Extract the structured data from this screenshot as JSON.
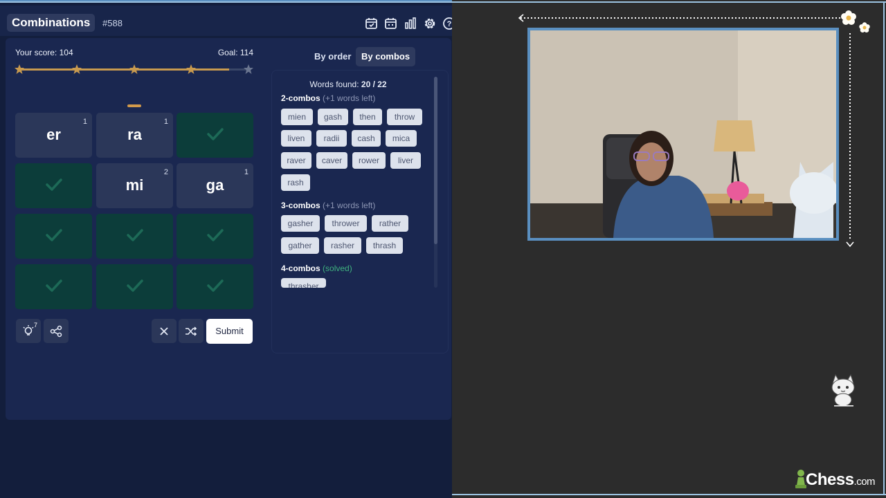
{
  "app": {
    "title": "Combinations",
    "puzzle_number": "#588"
  },
  "toolbar_icons": [
    "calendar-check-icon",
    "calendar-icon",
    "bar-chart-icon",
    "gear-icon",
    "help-icon"
  ],
  "score": {
    "label": "Your score: 104",
    "goal": "Goal: 114",
    "value": 104,
    "goal_value": 114,
    "stars_earned": 4,
    "stars_total": 5
  },
  "tiles": [
    {
      "label": "er",
      "count": "1",
      "done": false
    },
    {
      "label": "ra",
      "count": "1",
      "done": false
    },
    {
      "label": "",
      "count": "",
      "done": true
    },
    {
      "label": "",
      "count": "",
      "done": true
    },
    {
      "label": "mi",
      "count": "2",
      "done": false
    },
    {
      "label": "ga",
      "count": "1",
      "done": false
    },
    {
      "label": "",
      "count": "",
      "done": true
    },
    {
      "label": "",
      "count": "",
      "done": true
    },
    {
      "label": "",
      "count": "",
      "done": true
    },
    {
      "label": "",
      "count": "",
      "done": true
    },
    {
      "label": "",
      "count": "",
      "done": true
    },
    {
      "label": "",
      "count": "",
      "done": true
    }
  ],
  "controls": {
    "hint_count": "7",
    "submit_label": "Submit"
  },
  "view_tabs": {
    "by_order": "By order",
    "by_combos": "By combos",
    "active": "by_combos"
  },
  "words": {
    "found_label": "Words found: ",
    "found_count": "20 / 22",
    "sections": [
      {
        "title": "2-combos",
        "note": "(+1 words left)",
        "words": [
          "mien",
          "gash",
          "then",
          "throw",
          "liven",
          "radii",
          "cash",
          "mica",
          "raver",
          "caver",
          "rower",
          "liver",
          "rash"
        ]
      },
      {
        "title": "3-combos",
        "note": "(+1 words left)",
        "words": [
          "gasher",
          "thrower",
          "rather",
          "gather",
          "rasher",
          "thrash"
        ]
      },
      {
        "title": "4-combos",
        "note": "(solved)",
        "words": [
          "thrasher"
        ]
      }
    ]
  },
  "overlay": {
    "logo_text": "Chess",
    "logo_domain": ".com"
  }
}
